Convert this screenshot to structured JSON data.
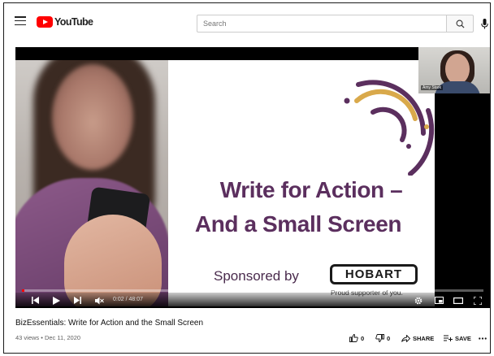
{
  "header": {
    "logo_text": "YouTube",
    "search_placeholder": "Search",
    "icons": [
      "menu-icon",
      "youtube-logo-icon",
      "search-icon",
      "microphone-icon"
    ]
  },
  "slide": {
    "title_line1": "Write for Action –",
    "title_line2": "And a Small Screen",
    "sponsored": "Sponsored by",
    "sponsor_logo": "HOBART",
    "sponsor_tagline": "Proud supporter of you."
  },
  "webcam": {
    "name": "Amy Stark"
  },
  "player": {
    "time": "0:02 / 48:07",
    "progress_fraction": 0.0007,
    "accent_color": "#ff0000",
    "icons": [
      "skip-previous-icon",
      "play-icon",
      "skip-next-icon",
      "volume-muted-icon",
      "settings-gear-icon",
      "miniplayer-icon",
      "theater-mode-icon",
      "fullscreen-icon"
    ]
  },
  "video": {
    "title": "BizEssentials: Write for Action and the Small Screen",
    "meta": "43 views • Dec 11, 2020",
    "likes": "0",
    "dislikes": "0",
    "share_label": "SHARE",
    "save_label": "SAVE"
  }
}
